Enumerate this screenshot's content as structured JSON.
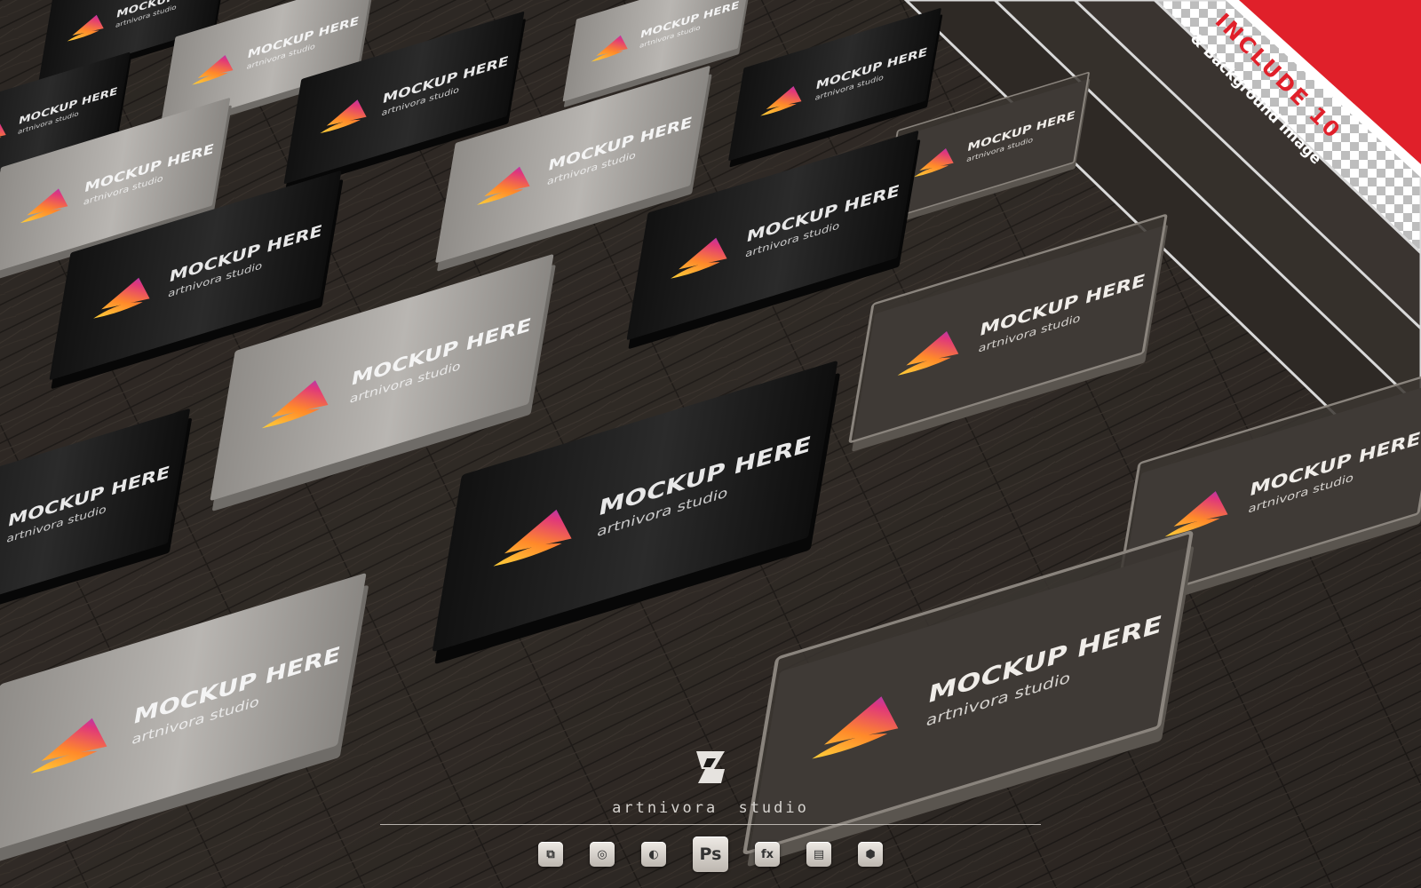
{
  "cards": {
    "title_text": "MOCKUP HERE",
    "subtitle_text": "artnivora studio"
  },
  "corner_banner": {
    "line1": "INCLUDE 10",
    "line2": "& Background Image"
  },
  "brand": {
    "logo_glyph": "a",
    "name": "artnivora studio"
  },
  "toolbar": {
    "tools": [
      {
        "icon": "smart-object-icon",
        "glyph": "⧉"
      },
      {
        "icon": "layers-icon",
        "glyph": "◎"
      },
      {
        "icon": "adjustment-icon",
        "glyph": "◐"
      },
      {
        "icon": "photoshop-icon",
        "glyph": "Ps"
      },
      {
        "icon": "effects-icon",
        "glyph": "fx"
      },
      {
        "icon": "file-icon",
        "glyph": "▤"
      },
      {
        "icon": "cube-3d-icon",
        "glyph": "⬢"
      }
    ]
  },
  "colors": {
    "accent_red": "#e0202a",
    "logo_gradient": [
      "#ffd23a",
      "#ff8a2a",
      "#e0377a",
      "#8a3dd9"
    ]
  }
}
